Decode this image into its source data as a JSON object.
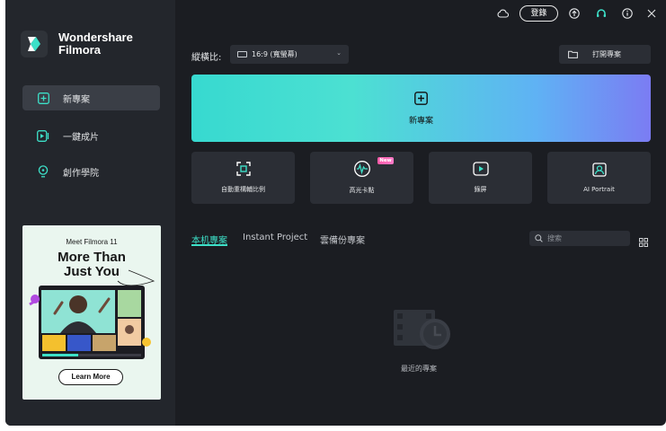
{
  "colors": {
    "accent": "#3de0c8",
    "bg": "#1b1d22",
    "sidebar": "#23262c",
    "panel": "#2b2e35"
  },
  "app": {
    "name_line1": "Wondershare",
    "name_line2": "Filmora"
  },
  "topbar": {
    "cloud_icon": "cloud-icon",
    "login_label": "登錄",
    "upload_icon": "arrow-up-circle-icon",
    "support_icon": "headset-icon",
    "info_icon": "info-icon",
    "close_icon": "close-icon"
  },
  "sidebar": {
    "items": [
      {
        "label": "新專案",
        "icon": "plus-square-icon",
        "active": true
      },
      {
        "label": "一鍵成片",
        "icon": "auto-clip-icon",
        "active": false
      },
      {
        "label": "創作學院",
        "icon": "lightbulb-icon",
        "active": false
      }
    ]
  },
  "promo": {
    "subtitle": "Meet Filmora 11",
    "headline1": "More Than",
    "headline2": "Just You",
    "button": "Learn More"
  },
  "main": {
    "ratio_label": "縱橫比:",
    "ratio_value": "16:9 (寬螢幕)",
    "open_label": "打開專案",
    "new_project": "新專案",
    "tiles": [
      {
        "label": "自動重構輔比例",
        "icon": "reframe-icon"
      },
      {
        "label": "高光卡點",
        "icon": "beat-sync-icon",
        "badge": "New"
      },
      {
        "label": "錄屏",
        "icon": "screen-record-icon"
      },
      {
        "label": "AI Portrait",
        "icon": "portrait-icon"
      }
    ],
    "tabs": [
      "本机專案",
      "Instant Project",
      "雲備份專案"
    ],
    "search_placeholder": "搜索",
    "empty_text": "最近的專案"
  }
}
